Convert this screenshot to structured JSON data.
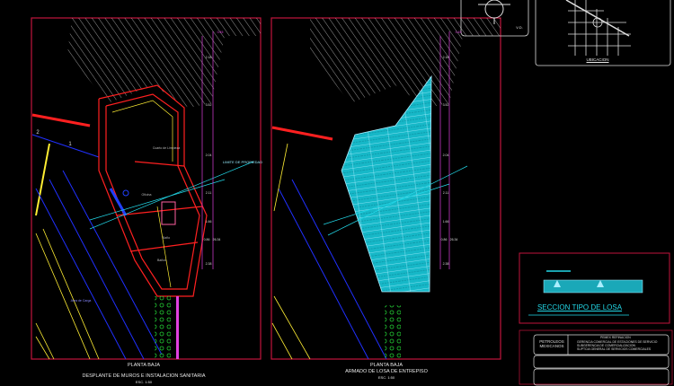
{
  "drawing": {
    "left_plan": {
      "title": "PLANTA BAJA",
      "subtitle": "DESPLANTE DE MUROS E INSTALACION SANITARIA",
      "scale": "ESC. 1:50",
      "rooms": [
        "Cuarto de Limpieza",
        "Oficina",
        "Baño",
        "Baños",
        "Area de Carga"
      ],
      "property_line": "LIMITE DE PROPIEDAD",
      "axis_labels": [
        "2",
        "1"
      ],
      "dimensions": [
        "0.45",
        "2.18",
        "3.52",
        "2.04",
        "2.11",
        "1.66",
        "0.86",
        "26.34",
        "2.38"
      ]
    },
    "right_plan": {
      "title": "PLANTA BAJA",
      "subtitle": "ARMADO DE LOSA DE ENTREPISO",
      "scale": "ESC. 1:50",
      "dimensions": [
        "0.45",
        "2.18",
        "3.52",
        "2.04",
        "2.11",
        "1.66",
        "0.86",
        "26.34",
        "2.38"
      ]
    },
    "compass": {
      "label": "V.D."
    },
    "location": {
      "label": "UBICACION"
    },
    "section": {
      "title": "SECCION TIPO DE LOSA"
    },
    "title_block": {
      "company": "PETROLEOS MEXICANOS",
      "division": "PEMEX REFINACION",
      "lines": [
        "GERENCIA COMERCIAL DE ESTACIONES DE SERVICIO",
        "SUBGERENCIA DE COMERCIALIZACION",
        "SUPTCIA GENERAL DE SERVICIOS COMERCIALES"
      ]
    },
    "colors": {
      "background": "#000000",
      "frame": "#c0143c",
      "walls": "#ff2020",
      "dimensions": "#e040e0",
      "slab": "#22d8e8",
      "axis": "#2030ff",
      "notes": "#ffee33",
      "vegetation": "#22cc33"
    }
  }
}
